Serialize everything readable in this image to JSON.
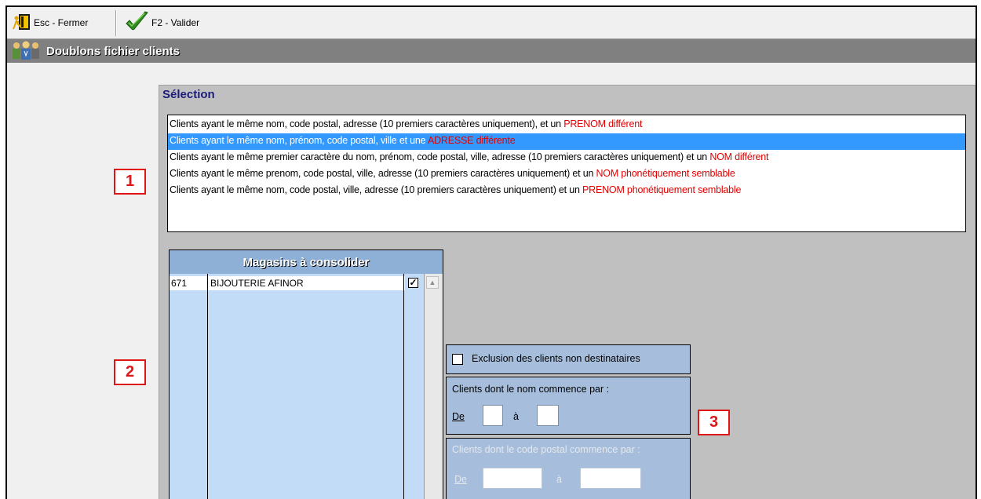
{
  "toolbar": {
    "esc_label": "Esc - Fermer",
    "validate_label": "F2 - Valider"
  },
  "window": {
    "title": "Doublons fichier clients"
  },
  "selection": {
    "title": "Sélection",
    "items": [
      {
        "text": "Clients ayant le même nom, code postal, adresse (10 premiers caractères uniquement), et un ",
        "highlight": "PRENOM différent",
        "selected": false
      },
      {
        "text": "Clients ayant le même nom, prénom, code postal, ville et une ",
        "highlight": "ADRESSE différente",
        "selected": true
      },
      {
        "text": "Clients ayant le même premier caractère du nom, prénom, code postal, ville, adresse (10 premiers caractères uniquement) et un ",
        "highlight": "NOM différent",
        "selected": false
      },
      {
        "text": "Clients ayant le même prenom, code postal, ville, adresse (10 premiers caractères uniquement) et un ",
        "highlight": "NOM phonétiquement semblable",
        "selected": false
      },
      {
        "text": "Clients ayant le même nom,  code postal, ville, adresse (10 premiers caractères uniquement) et un ",
        "highlight": "PRENOM  phonétiquement semblable",
        "selected": false
      }
    ]
  },
  "markers": [
    "1",
    "2",
    "3"
  ],
  "magasins": {
    "header": "Magasins à consolider",
    "rows": [
      {
        "code": "671",
        "name": "BIJOUTERIE AFINOR",
        "checked": "✓"
      }
    ]
  },
  "options": {
    "exclusion_label": "Exclusion des clients non destinataires",
    "nom_title": "Clients dont le nom commence par :",
    "nom_de": "De",
    "nom_a": "à",
    "cp_title": "Clients dont le code postal commence par :",
    "cp_de": "De",
    "cp_a": "à"
  },
  "colors": {
    "highlight": "#e00000",
    "selected_row": "#3399ff",
    "marker": "#e01515"
  }
}
